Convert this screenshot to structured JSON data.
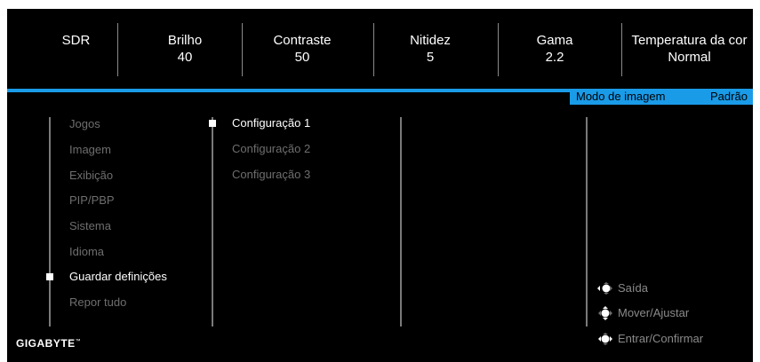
{
  "status_bar": [
    {
      "label": "SDR",
      "value": ""
    },
    {
      "label": "Brilho",
      "value": "40"
    },
    {
      "label": "Contraste",
      "value": "50"
    },
    {
      "label": "Nitidez",
      "value": "5"
    },
    {
      "label": "Gama",
      "value": "2.2"
    },
    {
      "label": "Temperatura da cor",
      "value": "Normal"
    }
  ],
  "header": {
    "mode_label": "Modo de imagem",
    "mode_value": "Padrão"
  },
  "menu": {
    "items": [
      {
        "label": "Jogos"
      },
      {
        "label": "Imagem"
      },
      {
        "label": "Exibição"
      },
      {
        "label": "PIP/PBP"
      },
      {
        "label": "Sistema"
      },
      {
        "label": "Idioma"
      },
      {
        "label": "Guardar definições",
        "selected": true
      },
      {
        "label": "Repor tudo"
      }
    ]
  },
  "submenu": {
    "items": [
      {
        "label": "Configuração 1",
        "selected": true
      },
      {
        "label": "Configuração 2"
      },
      {
        "label": "Configuração 3"
      }
    ]
  },
  "hints": {
    "exit": "Saída",
    "move": "Mover/Ajustar",
    "enter": "Entrar/Confirmar"
  },
  "brand": {
    "logo_text": "GIGABYTE"
  },
  "colors": {
    "accent": "#1a9be8",
    "background": "#000000"
  },
  "icons": [
    "joystick-left-icon",
    "joystick-updown-icon",
    "joystick-press-icon"
  ]
}
